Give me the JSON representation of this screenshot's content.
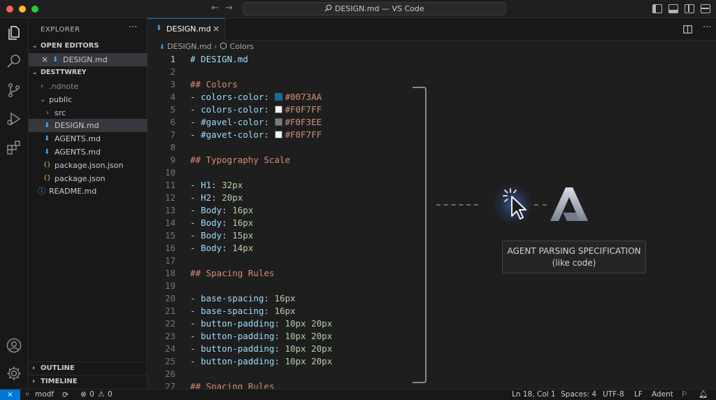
{
  "window": {
    "title": "DESIGN.md — VS Code"
  },
  "colors": {
    "accent": "#0078d4",
    "heading": "#d98a73",
    "key": "#9cdcfe",
    "string": "#ce9178",
    "number": "#b5cea8"
  },
  "sidebar": {
    "title": "EXPLORER",
    "more": "···",
    "open_editors": {
      "label": "OPEN EDITORS",
      "items": [
        {
          "label": "DESIGN.md",
          "close": "×"
        }
      ]
    },
    "workspace": {
      "label": "DESTTWREY"
    },
    "tree": [
      {
        "label": ".ndnote",
        "icon": "chevron-right-icon"
      },
      {
        "label": "public",
        "icon": "chevron-down-icon"
      },
      {
        "label": "src",
        "icon": "chevron-right-icon"
      },
      {
        "label": "DESIGN.md",
        "icon": "markdown-icon"
      },
      {
        "label": "AGENTS.md",
        "icon": "markdown-icon"
      },
      {
        "label": "AGENTS.md",
        "icon": "markdown-icon"
      },
      {
        "label": "package.json.json",
        "icon": "json-icon"
      },
      {
        "label": "package.json",
        "icon": "json-icon"
      },
      {
        "label": "README.md",
        "icon": "info-icon"
      }
    ],
    "outline": "OUTLINE",
    "timeline": "TIMELINE"
  },
  "editor": {
    "tab": {
      "label": "DESIGN.md",
      "close": "×"
    },
    "breadcrumb": {
      "file": "DESIGN.md",
      "symbol": "Colors"
    },
    "current_line": 1,
    "lines": [
      {
        "num": "1",
        "text": "# DESIGN.md"
      },
      {
        "num": "2",
        "text": ""
      },
      {
        "num": "3",
        "text": "## Colors"
      },
      {
        "num": "4",
        "key": "colors-color",
        "value": "#0073AA",
        "swatch": "#0073AA"
      },
      {
        "num": "5",
        "key": "colors-color",
        "value": "#F0F7FF",
        "swatch": "#F0F7FF"
      },
      {
        "num": "6",
        "key": "#gavel-color",
        "value": "#F0F3EE",
        "swatch": "#7a7a7a"
      },
      {
        "num": "7",
        "key": "#gavet-color",
        "value": "#F0F7FF",
        "swatch": "#F0F7FF"
      },
      {
        "num": "8",
        "text": ""
      },
      {
        "num": "9",
        "text": "## Typography Scale"
      },
      {
        "num": "10",
        "text": ""
      },
      {
        "num": "11",
        "key": "H1",
        "value": "32px"
      },
      {
        "num": "12",
        "key": "H2",
        "value": "20px"
      },
      {
        "num": "13",
        "key": "Body",
        "value": "16px"
      },
      {
        "num": "14",
        "key": "Body",
        "value": "16px"
      },
      {
        "num": "15",
        "key": "Body",
        "value": "15px"
      },
      {
        "num": "16",
        "key": "Body",
        "value": "14px"
      },
      {
        "num": "17",
        "text": ""
      },
      {
        "num": "18",
        "text": "## Spacing Rules"
      },
      {
        "num": "19",
        "text": ""
      },
      {
        "num": "20",
        "key": "base-spacing",
        "value": "16px"
      },
      {
        "num": "21",
        "key": "base-spacing",
        "value": "16px"
      },
      {
        "num": "22",
        "key": "button-padding",
        "value": "10px 20px"
      },
      {
        "num": "23",
        "key": "button-padding",
        "value": "10px 20px"
      },
      {
        "num": "24",
        "key": "button-padding",
        "value": "10px 20px"
      },
      {
        "num": "25",
        "key": "button-padding",
        "value": "10px 20px"
      },
      {
        "num": "26",
        "text": ""
      },
      {
        "num": "27",
        "text": "## Spacing Rules"
      }
    ]
  },
  "overlay": {
    "line1": "AGENT PARSING SPECIFICATION",
    "line2": "(like code)"
  },
  "status": {
    "branch": "modf",
    "errors": "0",
    "warnings": "0",
    "position": "Ln 18, Col 1",
    "spaces": "Spaces: 4",
    "encoding": "UTF-8",
    "eol": "LF",
    "agent": "Adent"
  }
}
